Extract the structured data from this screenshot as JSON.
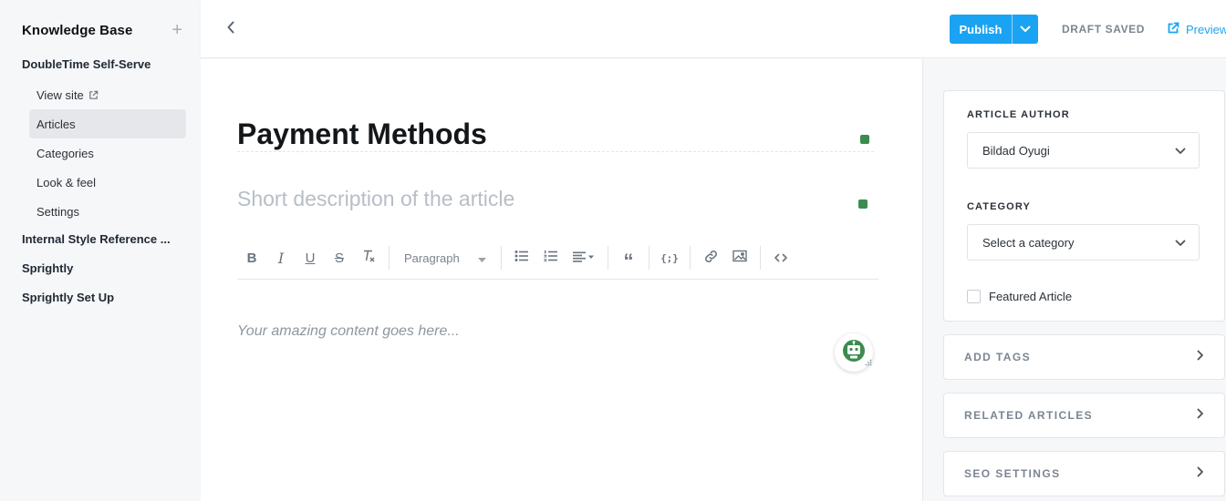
{
  "sidebar": {
    "title": "Knowledge Base",
    "add_icon": "plus-icon",
    "site_name": "DoubleTime Self-Serve",
    "items": [
      {
        "label": "View site",
        "icon": "external-link-icon"
      },
      {
        "label": "Articles",
        "active": true
      },
      {
        "label": "Categories"
      },
      {
        "label": "Look & feel"
      },
      {
        "label": "Settings"
      }
    ],
    "sections": [
      {
        "label": "Internal Style Reference ..."
      },
      {
        "label": "Sprightly"
      },
      {
        "label": "Sprightly Set Up"
      }
    ]
  },
  "topbar": {
    "back_icon": "chevron-left-icon",
    "publish_label": "Publish",
    "publish_caret_icon": "chevron-down-icon",
    "status": "DRAFT SAVED",
    "preview_label": "Preview",
    "preview_icon": "external-link-icon"
  },
  "editor": {
    "title": "Payment Methods",
    "description_placeholder": "Short description of the article",
    "toolbar": {
      "buttons": [
        "bold-icon",
        "italic-icon",
        "underline-icon",
        "strikethrough-icon",
        "clear-format-icon",
        "bullet-list-icon",
        "numbered-list-icon",
        "align-icon",
        "quote-icon",
        "code-block-icon",
        "link-icon",
        "image-icon",
        "source-code-icon"
      ],
      "paragraph_label": "Paragraph"
    },
    "content_placeholder": "Your amazing content goes here..."
  },
  "panel": {
    "author_label": "ARTICLE AUTHOR",
    "author_value": "Bildad Oyugi",
    "category_label": "CATEGORY",
    "category_placeholder": "Select a category",
    "featured_label": "Featured Article",
    "featured_checked": false,
    "sections": [
      {
        "label": "ADD TAGS"
      },
      {
        "label": "RELATED ARTICLES"
      },
      {
        "label": "SEO SETTINGS"
      }
    ]
  },
  "colors": {
    "accent": "#1aa3f2",
    "grammar_dot": "#3d8c4f",
    "sidebar_bg": "#f6f7f9"
  }
}
